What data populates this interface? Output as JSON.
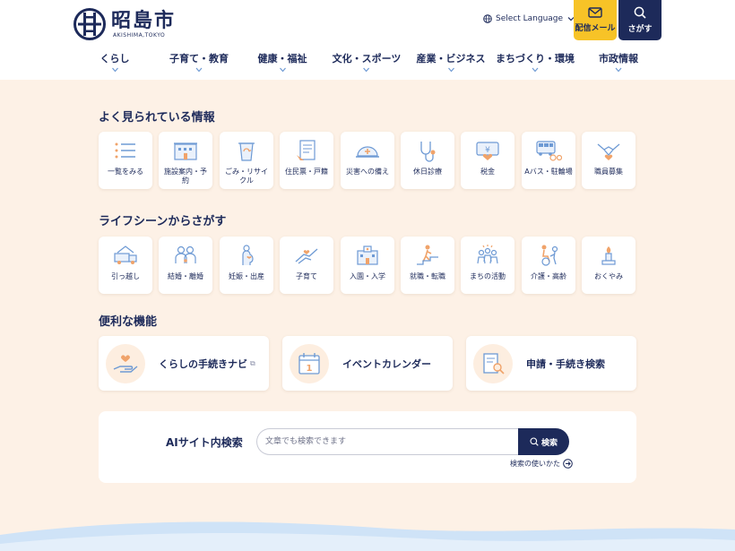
{
  "header": {
    "logo_title": "昭島市",
    "logo_sub": "AKISHIMA,TOKYO",
    "language_label": "Select Language",
    "mail_label": "配信メール",
    "search_label": "さがす"
  },
  "nav": [
    {
      "label": "くらし"
    },
    {
      "label": "子育て・教育"
    },
    {
      "label": "健康・福祉"
    },
    {
      "label": "文化・スポーツ"
    },
    {
      "label": "産業・ビジネス"
    },
    {
      "label": "まちづくり・環境"
    },
    {
      "label": "市政情報"
    }
  ],
  "popular": {
    "title": "よく見られている情報",
    "items": [
      {
        "label": "一覧をみる",
        "icon": "list-icon"
      },
      {
        "label": "施設案内・予約",
        "icon": "building-icon"
      },
      {
        "label": "ごみ・リサイクル",
        "icon": "trash-recycle-icon"
      },
      {
        "label": "住民票・戸籍",
        "icon": "document-icon"
      },
      {
        "label": "災害への備え",
        "icon": "helmet-icon"
      },
      {
        "label": "休日診療",
        "icon": "stethoscope-icon"
      },
      {
        "label": "税金",
        "icon": "tax-icon"
      },
      {
        "label": "Aバス・駐輪場",
        "icon": "bus-bicycle-icon"
      },
      {
        "label": "職員募集",
        "icon": "handshake-icon"
      }
    ]
  },
  "life": {
    "title": "ライフシーンからさがす",
    "items": [
      {
        "label": "引っ越し",
        "icon": "moving-truck-icon"
      },
      {
        "label": "結婚・離婚",
        "icon": "couple-icon"
      },
      {
        "label": "妊娠・出産",
        "icon": "pregnancy-icon"
      },
      {
        "label": "子育て",
        "icon": "parenting-icon"
      },
      {
        "label": "入園・入学",
        "icon": "school-icon"
      },
      {
        "label": "就職・転職",
        "icon": "career-icon"
      },
      {
        "label": "まちの活動",
        "icon": "community-icon"
      },
      {
        "label": "介護・高齢",
        "icon": "elderly-care-icon"
      },
      {
        "label": "おくやみ",
        "icon": "condolence-icon"
      }
    ]
  },
  "features": {
    "title": "便利な機能",
    "items": [
      {
        "label": "くらしの手続きナビ",
        "icon": "hand-heart-icon",
        "external": "⧉"
      },
      {
        "label": "イベントカレンダー",
        "icon": "calendar-icon",
        "external": ""
      },
      {
        "label": "申請・手続き検索",
        "icon": "document-search-icon",
        "external": ""
      }
    ]
  },
  "ai_search": {
    "title": "AIサイト内検索",
    "placeholder": "文章でも検索できます",
    "button_label": "検索",
    "help_label": "検索の使いかた"
  },
  "colors": {
    "navy": "#1d2a5a",
    "accent_yellow": "#f7c327",
    "page_bg": "#fdf1e6",
    "icon_blue": "#6e9ad4",
    "icon_orange": "#f0a36a"
  }
}
